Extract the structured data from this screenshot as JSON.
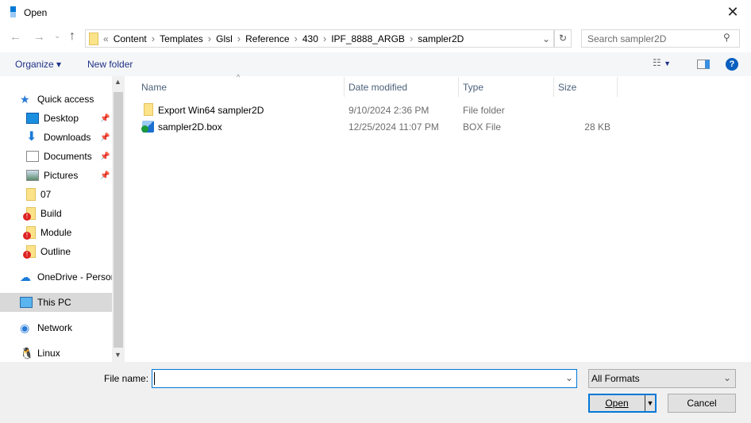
{
  "window": {
    "title": "Open",
    "close_glyph": "✕"
  },
  "address": {
    "overflow": "«",
    "crumbs": [
      "Content",
      "Templates",
      "Glsl",
      "Reference",
      "430",
      "IPF_8888_ARGB",
      "sampler2D"
    ]
  },
  "search": {
    "placeholder": "Search sampler2D"
  },
  "toolbar": {
    "organize": "Organize ▾",
    "new_folder": "New folder"
  },
  "sidebar": {
    "items": [
      {
        "label": "Quick access",
        "icon": "star-icon"
      },
      {
        "label": "Desktop",
        "icon": "desktop-icon",
        "pinned": true
      },
      {
        "label": "Downloads",
        "icon": "download-icon",
        "pinned": true
      },
      {
        "label": "Documents",
        "icon": "documents-icon",
        "pinned": true
      },
      {
        "label": "Pictures",
        "icon": "pictures-icon",
        "pinned": true
      },
      {
        "label": "07",
        "icon": "folder-icon"
      },
      {
        "label": "Build",
        "icon": "folder-warning-icon"
      },
      {
        "label": "Module",
        "icon": "folder-warning-icon"
      },
      {
        "label": "Outline",
        "icon": "folder-warning-icon"
      },
      {
        "label": "OneDrive - Persor",
        "icon": "cloud-icon"
      },
      {
        "label": "This PC",
        "icon": "computer-icon",
        "selected": true
      },
      {
        "label": "Network",
        "icon": "network-icon"
      },
      {
        "label": "Linux",
        "icon": "linux-icon"
      }
    ]
  },
  "columns": [
    "Name",
    "Date modified",
    "Type",
    "Size"
  ],
  "files": [
    {
      "name": "Export Win64 sampler2D",
      "date": "9/10/2024 2:36 PM",
      "type": "File folder",
      "size": "",
      "icon": "folder-icon"
    },
    {
      "name": "sampler2D.box",
      "date": "12/25/2024 11:07 PM",
      "type": "BOX File",
      "size": "28 KB",
      "icon": "box-file-icon"
    }
  ],
  "footer": {
    "file_name_label": "File name:",
    "file_name_value": "",
    "filter": "All Formats",
    "open": "Open",
    "cancel": "Cancel"
  },
  "colors": {
    "accent": "#0078d7",
    "selected": "#d9d9d9"
  }
}
